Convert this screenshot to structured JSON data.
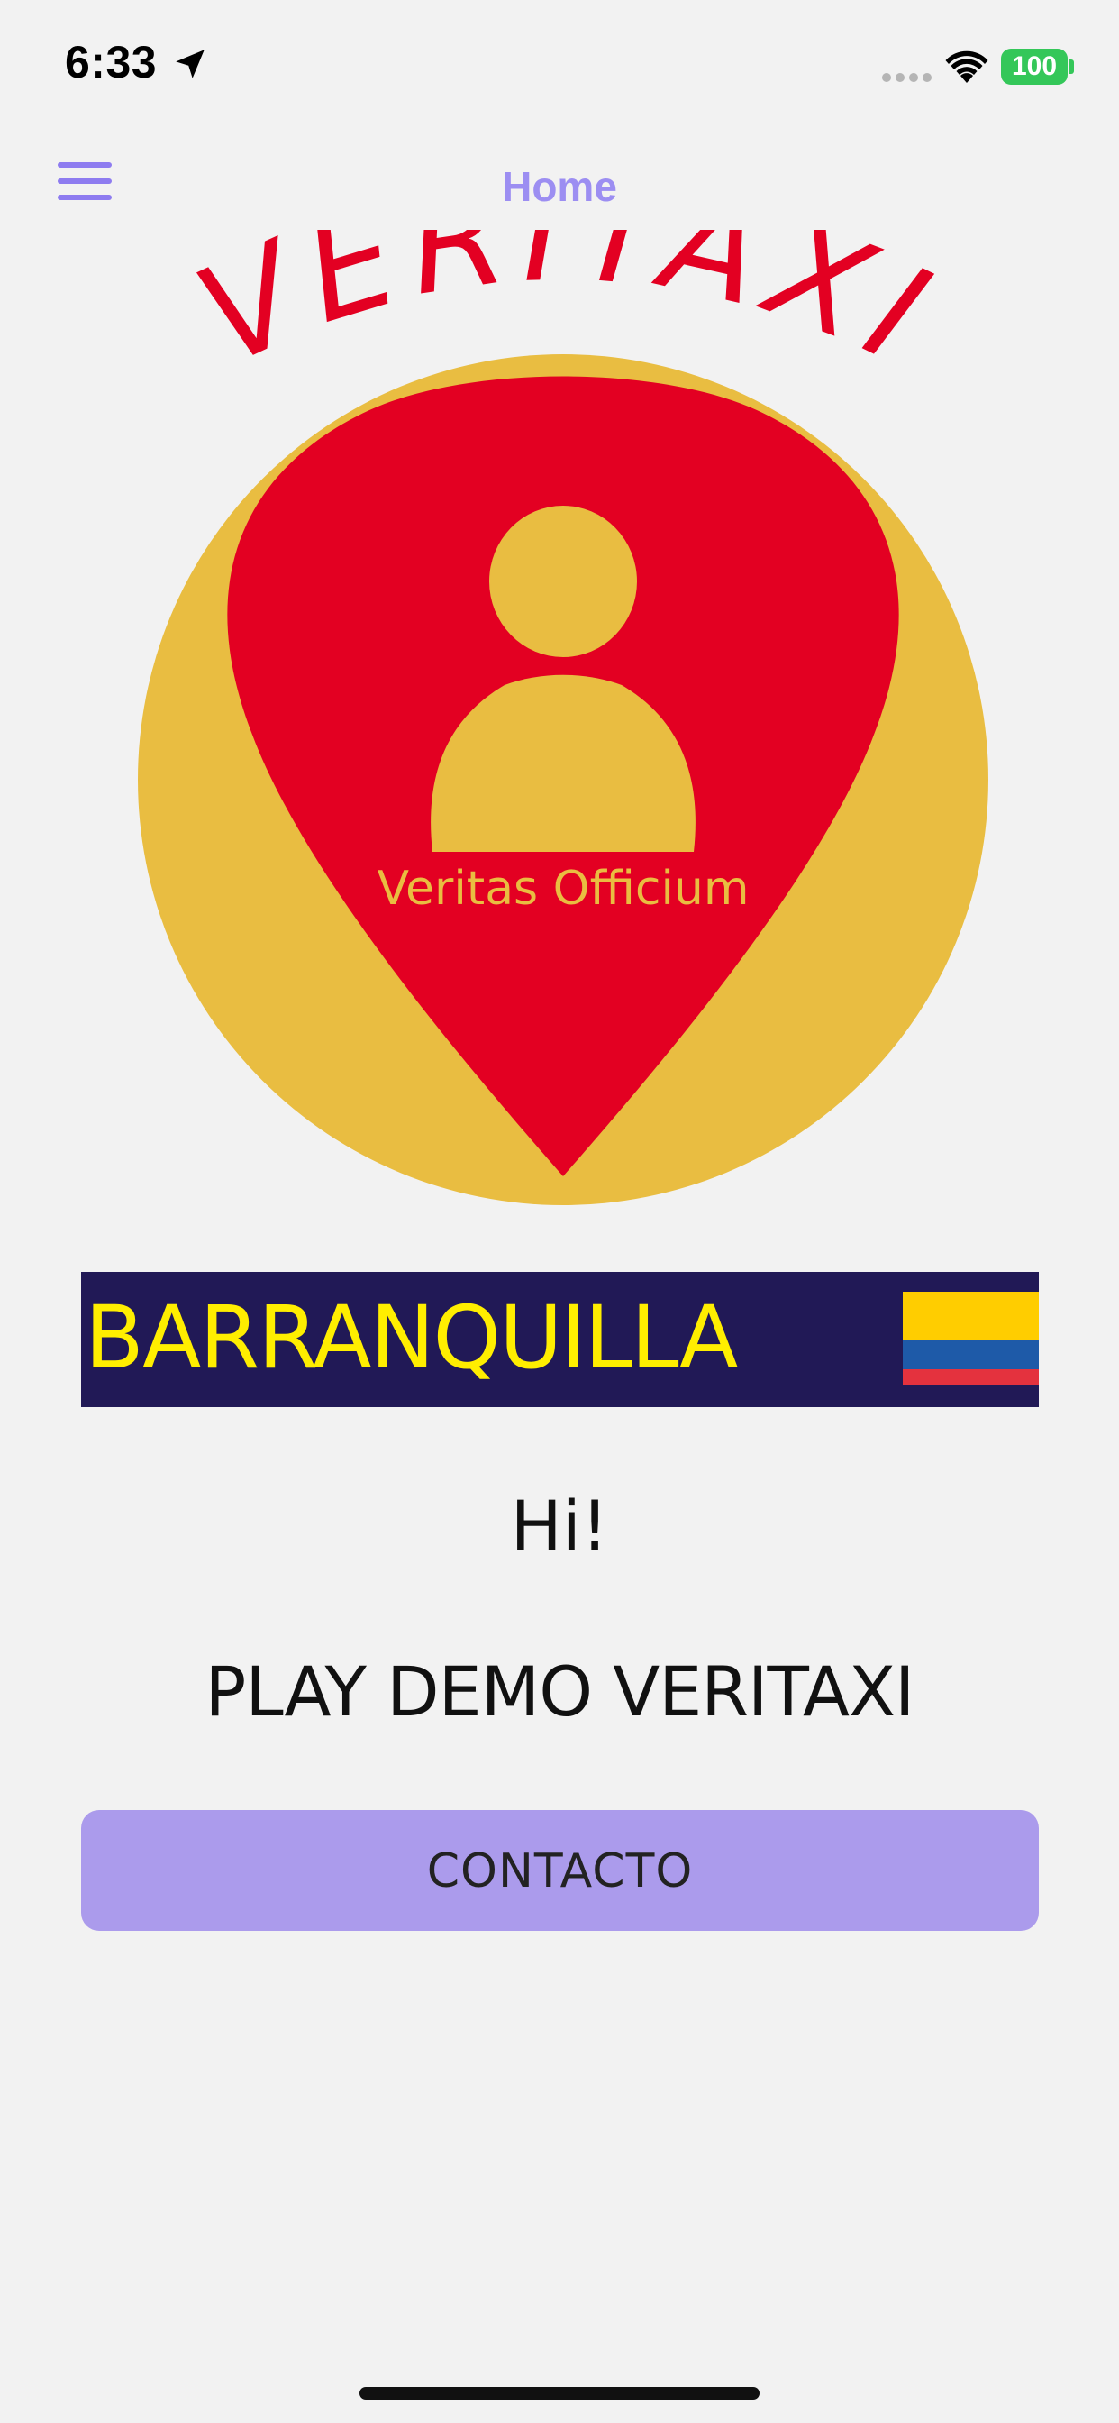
{
  "status_bar": {
    "time": "6:33",
    "battery": "100"
  },
  "nav": {
    "title": "Home"
  },
  "logo": {
    "wordmark": "VERITAXI",
    "tagline": "Veritas Officium",
    "colors": {
      "red": "#e30022",
      "gold": "#e9bd41"
    }
  },
  "city": {
    "name": "BARRANQUILLA",
    "text_color": "#ffee00",
    "background": "#211956"
  },
  "greeting": "Hi!",
  "demo_title": "PLAY DEMO VERITAXI",
  "contact_button": {
    "label": "CONTACTO",
    "color": "#ab9bec"
  },
  "icons": [
    "location-arrow-icon",
    "cellular-signal-icon",
    "wifi-icon",
    "battery-icon",
    "hamburger-menu-icon",
    "colombia-flag-icon",
    "person-pin-icon"
  ]
}
